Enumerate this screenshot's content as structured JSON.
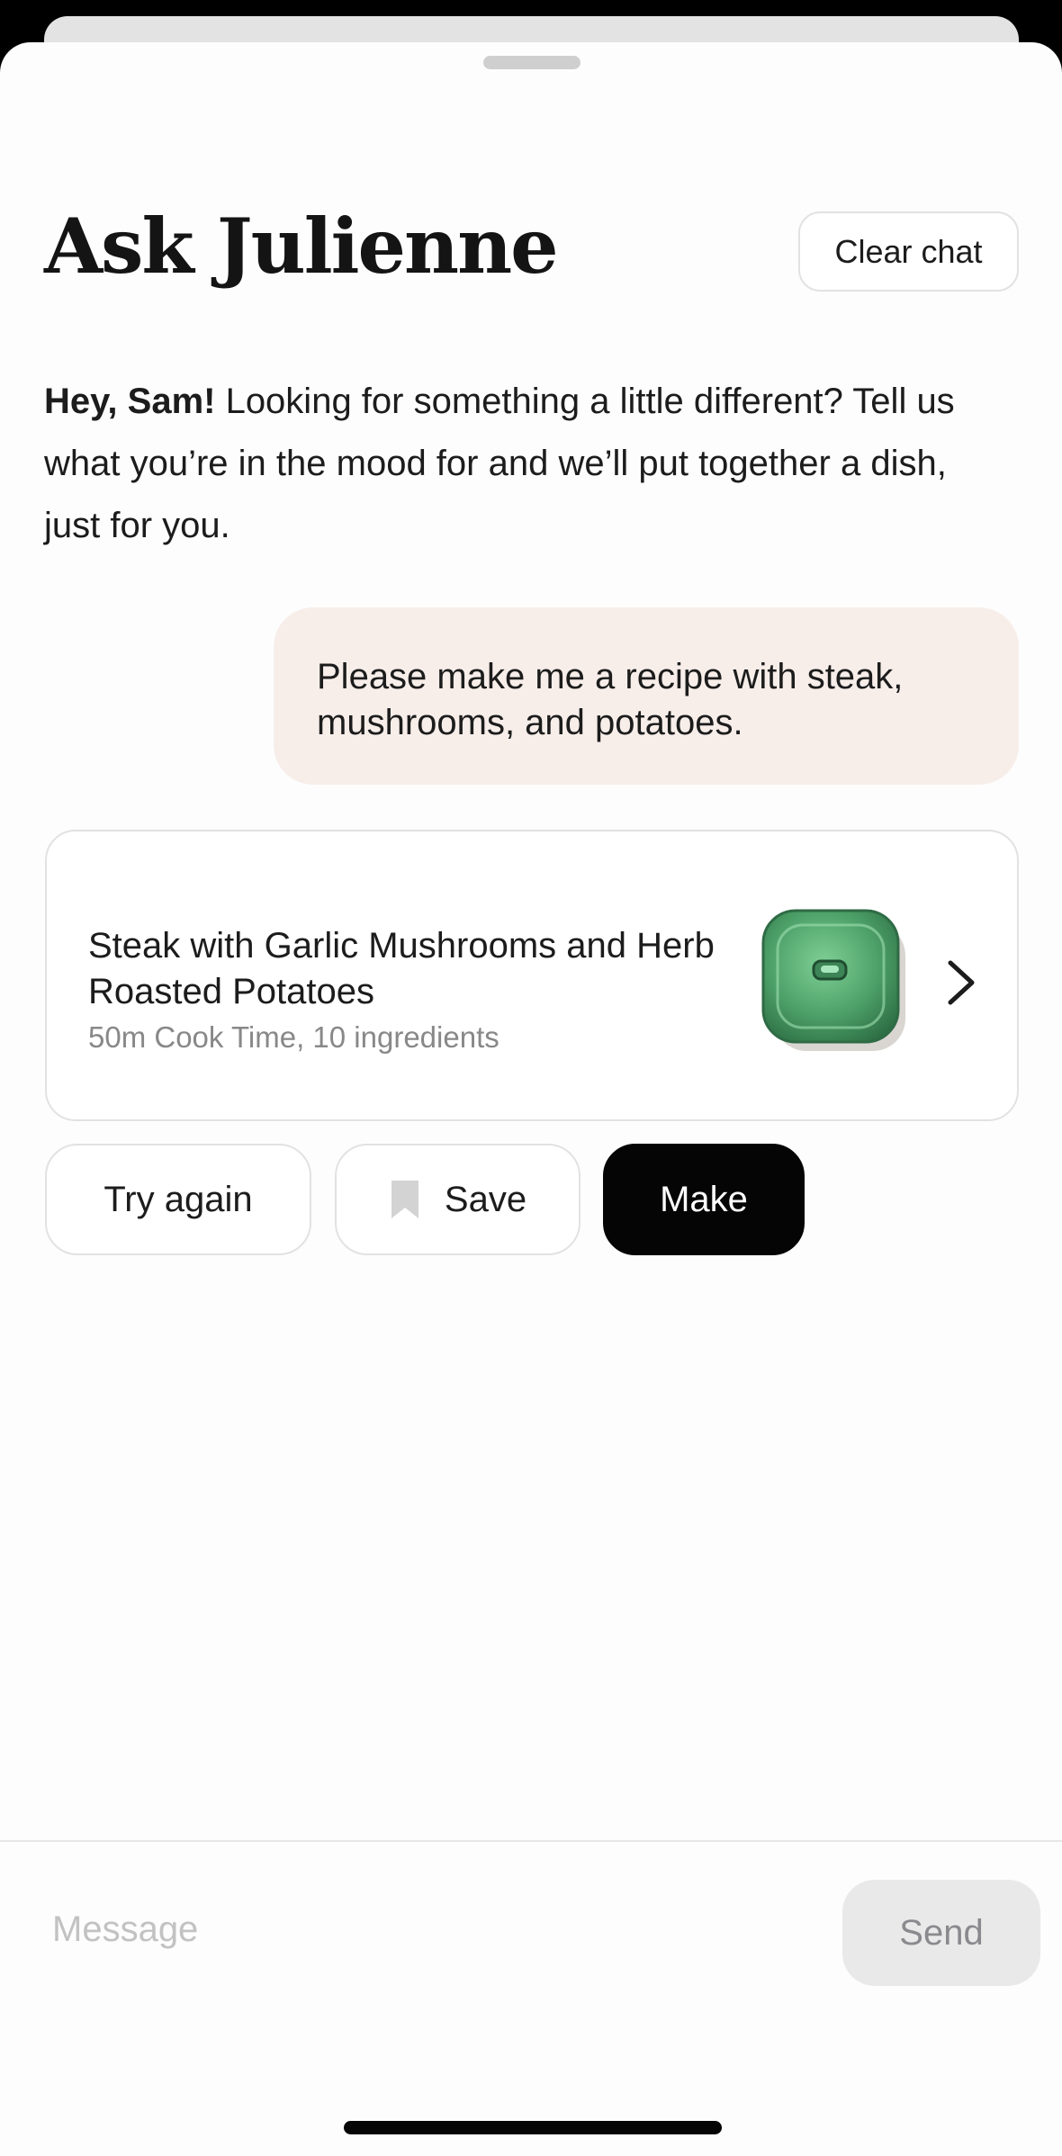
{
  "sheet": {
    "title": "Ask Julienne",
    "clear_chat_label": "Clear chat"
  },
  "greeting": {
    "name_bold": "Hey, Sam!",
    "text": " Looking for something a little different? Tell us what you’re in the mood for and we’ll put together a dish, just for you."
  },
  "chat": {
    "user_message": "Please make me a recipe with steak, mushrooms, and potatoes.",
    "recipe": {
      "title": "Steak with Garlic Mushrooms and Herb Roasted Potatoes",
      "meta": "50m Cook Time, 10 ingredients",
      "thumbnail_icon": "green-dish-image",
      "chevron_icon": "chevron-right-icon"
    },
    "actions": {
      "try_again_label": "Try again",
      "save_label": "Save",
      "save_icon": "bookmark-icon",
      "make_label": "Make"
    }
  },
  "composer": {
    "placeholder": "Message",
    "send_label": "Send"
  },
  "colors": {
    "user_bubble": "#f7eeea",
    "primary_button": "#050505",
    "send_disabled": "#e9e9ea",
    "dish_green": "#4fa36a"
  }
}
